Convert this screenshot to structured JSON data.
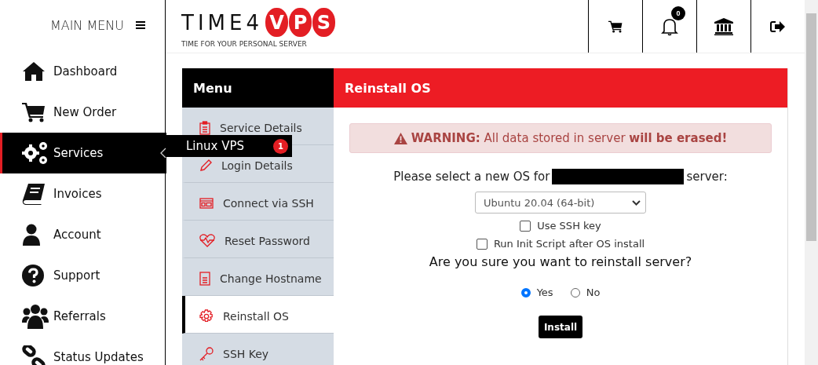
{
  "sidebar": {
    "title": "MAIN MENU",
    "items": [
      {
        "label": "Dashboard",
        "selected": false
      },
      {
        "label": "New Order",
        "selected": false
      },
      {
        "label": "Services",
        "selected": true
      },
      {
        "label": "Invoices",
        "selected": false
      },
      {
        "label": "Account",
        "selected": false
      },
      {
        "label": "Support",
        "selected": false
      },
      {
        "label": "Referrals",
        "selected": false
      },
      {
        "label": "Status Updates",
        "selected": false
      }
    ]
  },
  "flyout": {
    "label": "Linux VPS",
    "badge": "1"
  },
  "header": {
    "logo": {
      "word": "TIME4",
      "circles": [
        "V",
        "P",
        "S"
      ],
      "tagline": "TIME FOR YOUR PERSONAL SERVER"
    },
    "notifications": "0"
  },
  "service_menu": {
    "title": "Menu",
    "items": [
      {
        "label": "Service Details",
        "selected": false
      },
      {
        "label": "Login Details",
        "selected": false
      },
      {
        "label": "Connect via SSH",
        "selected": false
      },
      {
        "label": "Reset Password",
        "selected": false
      },
      {
        "label": "Change Hostname",
        "selected": false
      },
      {
        "label": "Reinstall OS",
        "selected": true
      },
      {
        "label": "SSH Key",
        "selected": false
      }
    ]
  },
  "panel": {
    "title": "Reinstall OS",
    "warning": "**WARNING:** All data stored in server **will be erased!**",
    "prompt_before": "Please select a new OS for",
    "prompt_after": "server:",
    "os_select": "Ubuntu 20.04 (64-bit)",
    "options": [
      {
        "label": "Use SSH key",
        "checked": false
      },
      {
        "label": "Run Init Script after OS install",
        "checked": false
      }
    ],
    "question": "Are you sure you want to reinstall server?",
    "answers": [
      {
        "label": "Yes",
        "selected": true
      },
      {
        "label": "No",
        "selected": false
      }
    ],
    "button": "Install"
  }
}
